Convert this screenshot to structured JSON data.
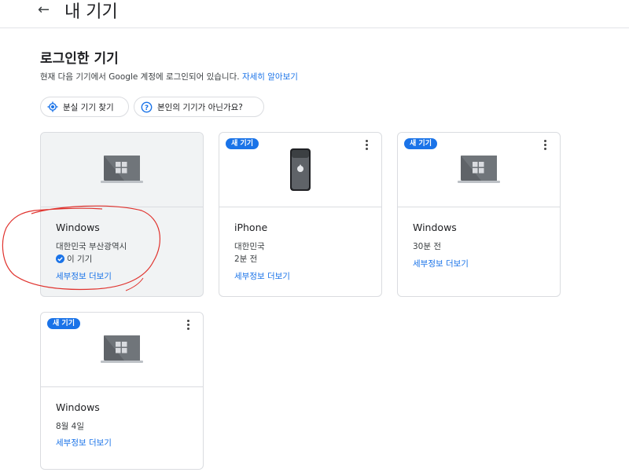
{
  "header": {
    "back_icon": "arrow-back-icon",
    "title": "내 기기"
  },
  "section": {
    "title": "로그인한 기기",
    "description": "현재 다음 기기에서 Google 계정에 로그인되어 있습니다.",
    "learn_more": "자세히 알아보기"
  },
  "actions": [
    {
      "icon": "locate-icon",
      "label": "분실 기기 찾기"
    },
    {
      "icon": "help-circle-icon",
      "label": "본인의 기기가 아닌가요?"
    }
  ],
  "devices": [
    {
      "type": "windows-laptop",
      "name": "Windows",
      "location": "대한민국 부산광역시",
      "status": "이 기기",
      "badge": "",
      "more": "세부정보 더보기"
    },
    {
      "type": "iphone",
      "name": "iPhone",
      "location": "대한민국",
      "status": "2분 전",
      "badge": "새 기기",
      "more": "세부정보 더보기"
    },
    {
      "type": "windows-laptop",
      "name": "Windows",
      "location": "30분 전",
      "status": "",
      "badge": "새 기기",
      "more": "세부정보 더보기"
    },
    {
      "type": "windows-laptop",
      "name": "Windows",
      "location": "8월 4일",
      "status": "",
      "badge": "새 기기",
      "more": "세부정보 더보기"
    }
  ],
  "colors": {
    "accent": "#1a73e8",
    "annotation": "#e0332e",
    "card_border": "#dadce0"
  }
}
